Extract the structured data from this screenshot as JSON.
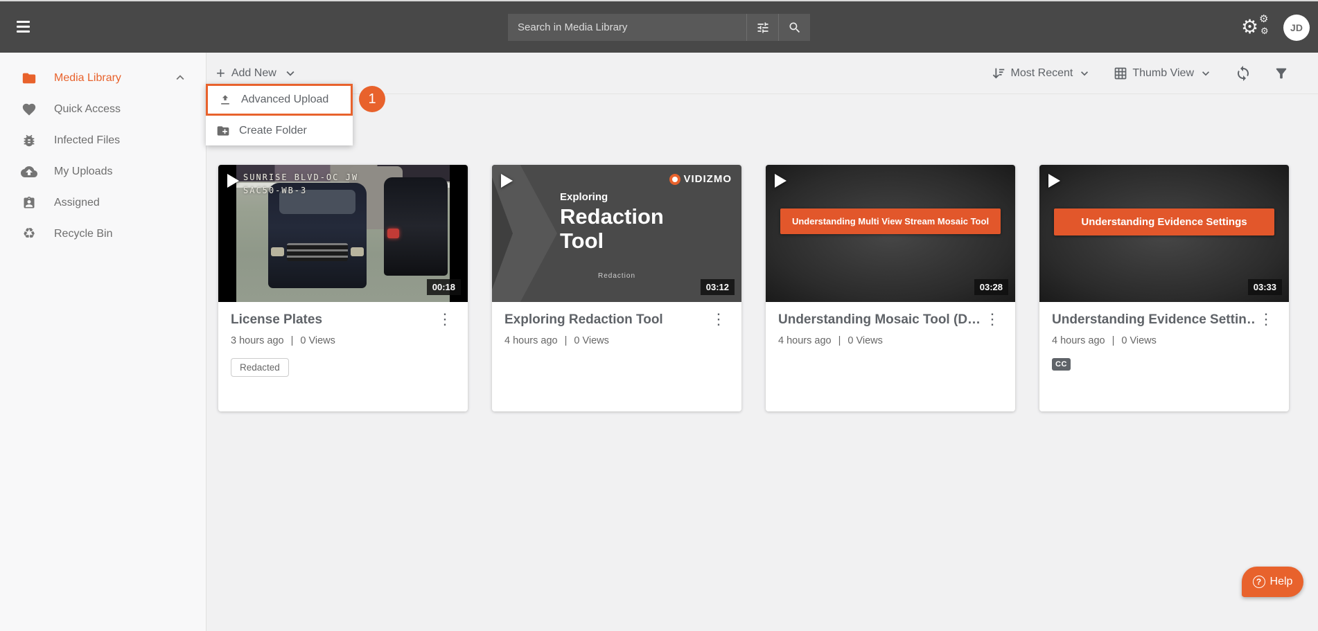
{
  "topbar": {
    "search_placeholder": "Search in Media Library",
    "avatar_initials": "JD"
  },
  "sidebar": {
    "items": [
      {
        "label": "Media Library",
        "icon": "folder",
        "active": true
      },
      {
        "label": "Quick Access",
        "icon": "heart"
      },
      {
        "label": "Infected Files",
        "icon": "bug"
      },
      {
        "label": "My Uploads",
        "icon": "cloud-upload"
      },
      {
        "label": "Assigned",
        "icon": "id-badge"
      },
      {
        "label": "Recycle Bin",
        "icon": "recycle"
      }
    ]
  },
  "toolbar": {
    "add_new_label": "Add New",
    "sort_label": "Most Recent",
    "view_label": "Thumb View"
  },
  "dropdown": {
    "advanced_upload_label": "Advanced Upload",
    "create_folder_label": "Create Folder",
    "step_badge": "1"
  },
  "ui": {
    "meta_separator": "|"
  },
  "icons": {
    "kebab_glyph": "⋮",
    "recycle_glyph": "♻",
    "plus_glyph": "+",
    "question_glyph": "?",
    "gear_glyph": "⚙"
  },
  "cards": [
    {
      "title": "License Plates",
      "duration": "00:18",
      "age": "3 hours ago",
      "views": "0 Views",
      "tag": "Redacted",
      "thumb_overlay_line1": "SUNRISE BLVD-OC JW",
      "thumb_overlay_line2": "SAC50-WB-3"
    },
    {
      "title": "Exploring Redaction Tool",
      "duration": "03:12",
      "age": "4 hours ago",
      "views": "0 Views",
      "thumb_brand": "VIDIZMO",
      "thumb_heading_small": "Exploring",
      "thumb_heading_line1": "Redaction",
      "thumb_heading_line2": "Tool",
      "thumb_caption": "Redaction"
    },
    {
      "title": "Understanding Mosaic Tool (D…",
      "duration": "03:28",
      "age": "4 hours ago",
      "views": "0 Views",
      "thumb_banner": "Understanding Multi View Stream Mosaic Tool"
    },
    {
      "title": "Understanding Evidence Settin…",
      "duration": "03:33",
      "age": "4 hours ago",
      "views": "0 Views",
      "thumb_banner": "Understanding Evidence Settings",
      "cc_badge": "CC"
    }
  ],
  "help": {
    "label": "Help"
  },
  "colors": {
    "accent": "#e8622c",
    "topbar": "#484848",
    "banner_orange": "#e2572b"
  }
}
